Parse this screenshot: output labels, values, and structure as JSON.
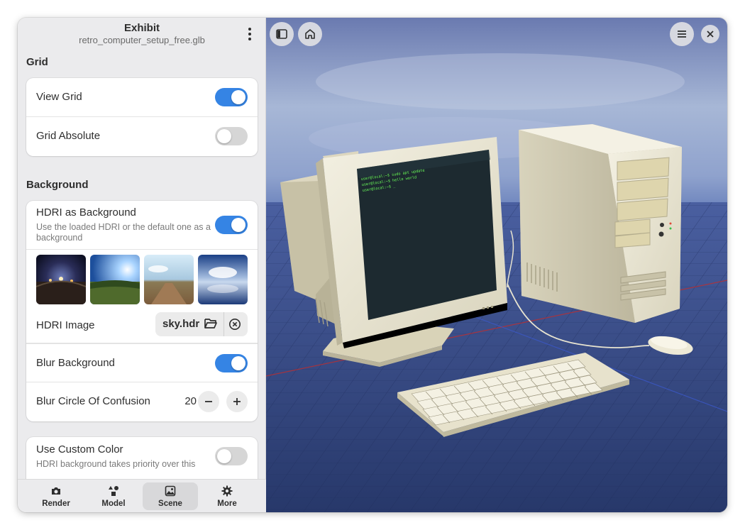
{
  "app": {
    "title": "Exhibit",
    "subtitle": "retro_computer_setup_free.glb"
  },
  "grid": {
    "title": "Grid",
    "view_grid": {
      "label": "View Grid",
      "on": true
    },
    "grid_absolute": {
      "label": "Grid Absolute",
      "on": false
    }
  },
  "background": {
    "title": "Background",
    "hdri_bg": {
      "label": "HDRI as Background",
      "description": "Use the loaded HDRI or the default one as a background",
      "on": true
    },
    "hdri_image": {
      "label": "HDRI Image",
      "file": "sky.hdr"
    },
    "blur_bg": {
      "label": "Blur Background",
      "on": true
    },
    "blur_coc": {
      "label": "Blur Circle Of Confusion",
      "value": "20"
    },
    "custom_color": {
      "label": "Use Custom Color",
      "description": "HDRI background takes priority over this",
      "on": false
    }
  },
  "nav": {
    "tabs": [
      {
        "label": "Render",
        "icon": "camera-icon"
      },
      {
        "label": "Model",
        "icon": "shapes-icon"
      },
      {
        "label": "Scene",
        "icon": "image-icon",
        "active": true
      },
      {
        "label": "More",
        "icon": "gear-icon"
      }
    ]
  },
  "viewport": {
    "terminal_lines": [
      "user@local:~$ sudo apt update",
      "user@local:~$ hello world",
      "user@local:~$ _"
    ]
  },
  "colors": {
    "accent": "#3584e4",
    "sidebar_bg": "#ebebed",
    "card_bg": "#ffffff"
  }
}
